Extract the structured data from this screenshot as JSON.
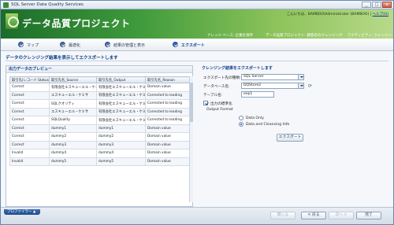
{
  "window": {
    "title": "SQL Server Data Quality Services",
    "minimize": "_",
    "maximize": "□",
    "close": "x"
  },
  "header": {
    "project_title": "データ品質プロジェクト",
    "user_text": "こんにちは、BAMBOO\\Administrator (BAMBOO) |",
    "help_label": "ヘルプ(H)",
    "breadcrumbs": [
      "ナレッジ ベース: 企業社保存",
      "データ品質プロジェクト: 顧客名のクレンジング",
      "アクティビティ: クレンジング"
    ]
  },
  "steps": [
    {
      "label": "マップ",
      "active": false
    },
    {
      "label": "最適化",
      "active": false
    },
    {
      "label": "結果の管理と表示",
      "active": false
    },
    {
      "label": "エクスポート",
      "active": true
    }
  ],
  "instruction": "データのクレンジング結果を表示してエクスポートします",
  "preview": {
    "title": "出力データのプレビュー",
    "columns": [
      "取引先(レコード Status)",
      "取引先名_Source",
      "取引先名_Output",
      "取引先名_Reason"
    ],
    "rows": [
      [
        "Correct",
        "有限会社エスキューエル・ケミサ",
        "有限会社エスキューエル・ケミサ",
        "Domain value"
      ],
      [
        "Correct",
        "エスキューエル・ケミサ",
        "有限会社エスキューエル・ケミサ",
        "Corrected to leading"
      ],
      [
        "Correct",
        "SQLクオリティ",
        "有限会社エスキューエル・ケミサ",
        "Corrected to leading"
      ],
      [
        "Correct",
        "エスキューエル・ケミサ",
        "有限会社エスキューエル・ケミサ",
        "Corrected to leading"
      ],
      [
        "Correct",
        "SQLQuality",
        "有限会社エスキューエル・ケミサ",
        "Corrected to leading"
      ],
      [
        "Correct",
        "dummy1",
        "dummy1",
        "Domain value"
      ],
      [
        "Correct",
        "dummy2",
        "dummy2",
        "Domain value"
      ],
      [
        "Correct",
        "dummy3",
        "dummy3",
        "Domain value"
      ],
      [
        "Invalid",
        "dummy4",
        "dummy4",
        "Domain value"
      ],
      [
        "Invalid",
        "dummy5",
        "dummy5",
        "Domain value"
      ]
    ]
  },
  "export": {
    "title": "クレンジング結果をエクスポートします",
    "destination_label": "エクスポート先の種類:",
    "destination_value": "SQL Server",
    "database_label": "データベース名:",
    "database_value": "DQStore2",
    "table_label": "テーブル名:",
    "table_value": "exp1",
    "standardize_label": "出力の標準化",
    "output_format_label": "Output Format",
    "radio_data_only": "Data Only",
    "radio_data_cleansing": "Data and Cleansing Info",
    "export_button": "エクスポート"
  },
  "footer": {
    "tab_label": "プロファイラー ▲",
    "close_button": "閉じる",
    "back_button": "< 戻る",
    "next_button": "次へ >",
    "finish_button": "完了"
  }
}
